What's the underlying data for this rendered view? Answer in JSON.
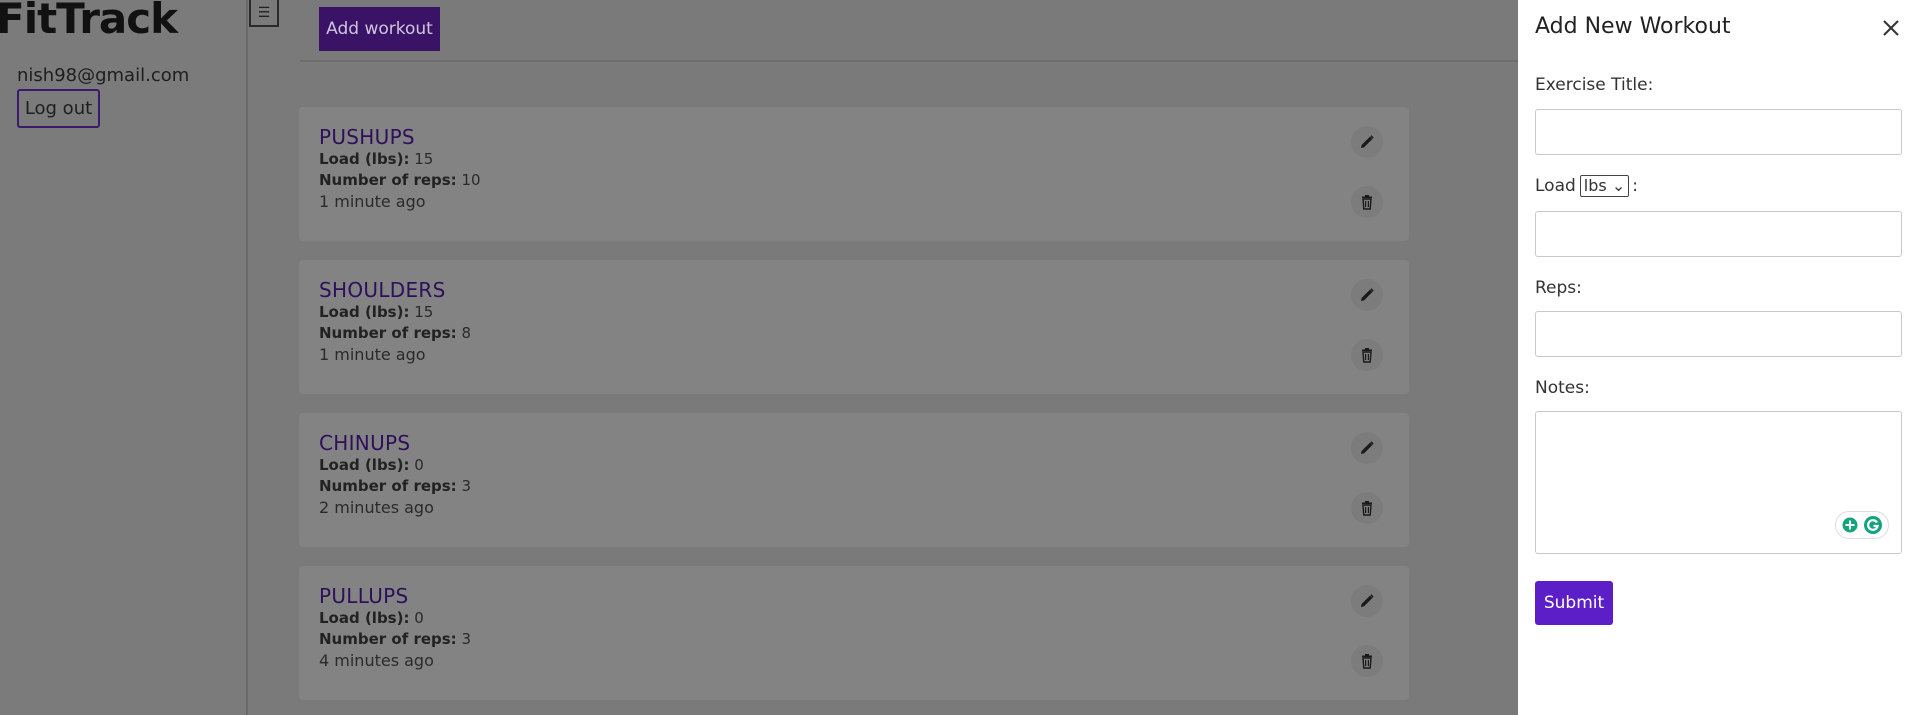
{
  "app": {
    "brand": "FitTrack"
  },
  "sidebar": {
    "user_email": "nish98@gmail.com",
    "logout_label": "Log out"
  },
  "menu_toggle": {
    "icon": "hamburger-icon",
    "glyph": "☰"
  },
  "toolbar": {
    "add_workout_label": "Add workout"
  },
  "workouts": [
    {
      "title": "PUSHUPS",
      "load_label": "Load (lbs):",
      "load": "15",
      "reps_label": "Number of reps:",
      "reps": "10",
      "time": "1 minute ago"
    },
    {
      "title": "SHOULDERS",
      "load_label": "Load (lbs):",
      "load": "15",
      "reps_label": "Number of reps:",
      "reps": "8",
      "time": "1 minute ago"
    },
    {
      "title": "CHINUPS",
      "load_label": "Load (lbs):",
      "load": "0",
      "reps_label": "Number of reps:",
      "reps": "3",
      "time": "2 minutes ago"
    },
    {
      "title": "PULLUPS",
      "load_label": "Load (lbs):",
      "load": "0",
      "reps_label": "Number of reps:",
      "reps": "3",
      "time": "4 minutes ago"
    }
  ],
  "drawer": {
    "title": "Add New Workout",
    "exercise_title_label": "Exercise Title:",
    "exercise_title_value": "",
    "load_label": "Load",
    "load_colon": ":",
    "load_unit_selected": "lbs",
    "load_value": "",
    "reps_label": "Reps:",
    "reps_value": "",
    "notes_label": "Notes:",
    "notes_value": "",
    "submit_label": "Submit"
  },
  "colors": {
    "accent": "#5c1fc7",
    "add_button_bg": "#3a1366",
    "title_purple": "#2e0f5b"
  }
}
